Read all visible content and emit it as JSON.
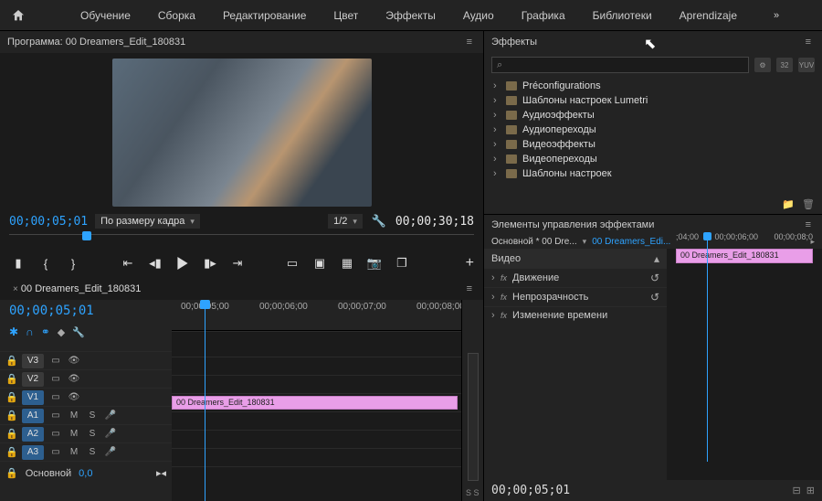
{
  "menu": {
    "items": [
      "Обучение",
      "Сборка",
      "Редактирование",
      "Цвет",
      "Эффекты",
      "Аудио",
      "Графика",
      "Библиотеки",
      "Aprendizaje"
    ],
    "more": "»"
  },
  "program": {
    "title_prefix": "Программа:",
    "sequence": "00 Dreamers_Edit_180831",
    "tc_in": "00;00;05;01",
    "tc_out": "00;00;30;18",
    "zoom_fit": "По размеру кадра",
    "playback_res": "1/2"
  },
  "timeline": {
    "tab": "00 Dreamers_Edit_180831",
    "tc": "00;00;05;01",
    "ruler": [
      "00;00;05;00",
      "00;00;06;00",
      "00;00;07;00",
      "00;00;08;00"
    ],
    "video_tracks": [
      "V3",
      "V2",
      "V1"
    ],
    "audio_tracks": [
      "A1",
      "A2",
      "A3"
    ],
    "clip": "00 Dreamers_Edit_180831",
    "master": "Основной",
    "master_val": "0,0",
    "ss": "S  S"
  },
  "effects": {
    "title": "Эффекты",
    "search_placeholder": "",
    "badges": [
      "⚙",
      "32",
      "YUV"
    ],
    "items": [
      "Préconfigurations",
      "Шаблоны настроек Lumetri",
      "Аудиоэффекты",
      "Аудиопереходы",
      "Видеоэффекты",
      "Видеопереходы",
      "Шаблоны настроек"
    ]
  },
  "fxctrl": {
    "title": "Элементы управления эффектами",
    "src_prefix": "Основной * 00 Dre...",
    "seq_link": "00 Dreamers_Edi...",
    "ruler": [
      ";04;00",
      "00;00;06;00",
      "00;00;08;0"
    ],
    "mini_clip": "00 Dreamers_Edit_180831",
    "group_video": "Видео",
    "prop_motion": "Движение",
    "prop_opacity": "Непрозрачность",
    "prop_time": "Изменение времени",
    "tc_foot": "00;00;05;01"
  }
}
